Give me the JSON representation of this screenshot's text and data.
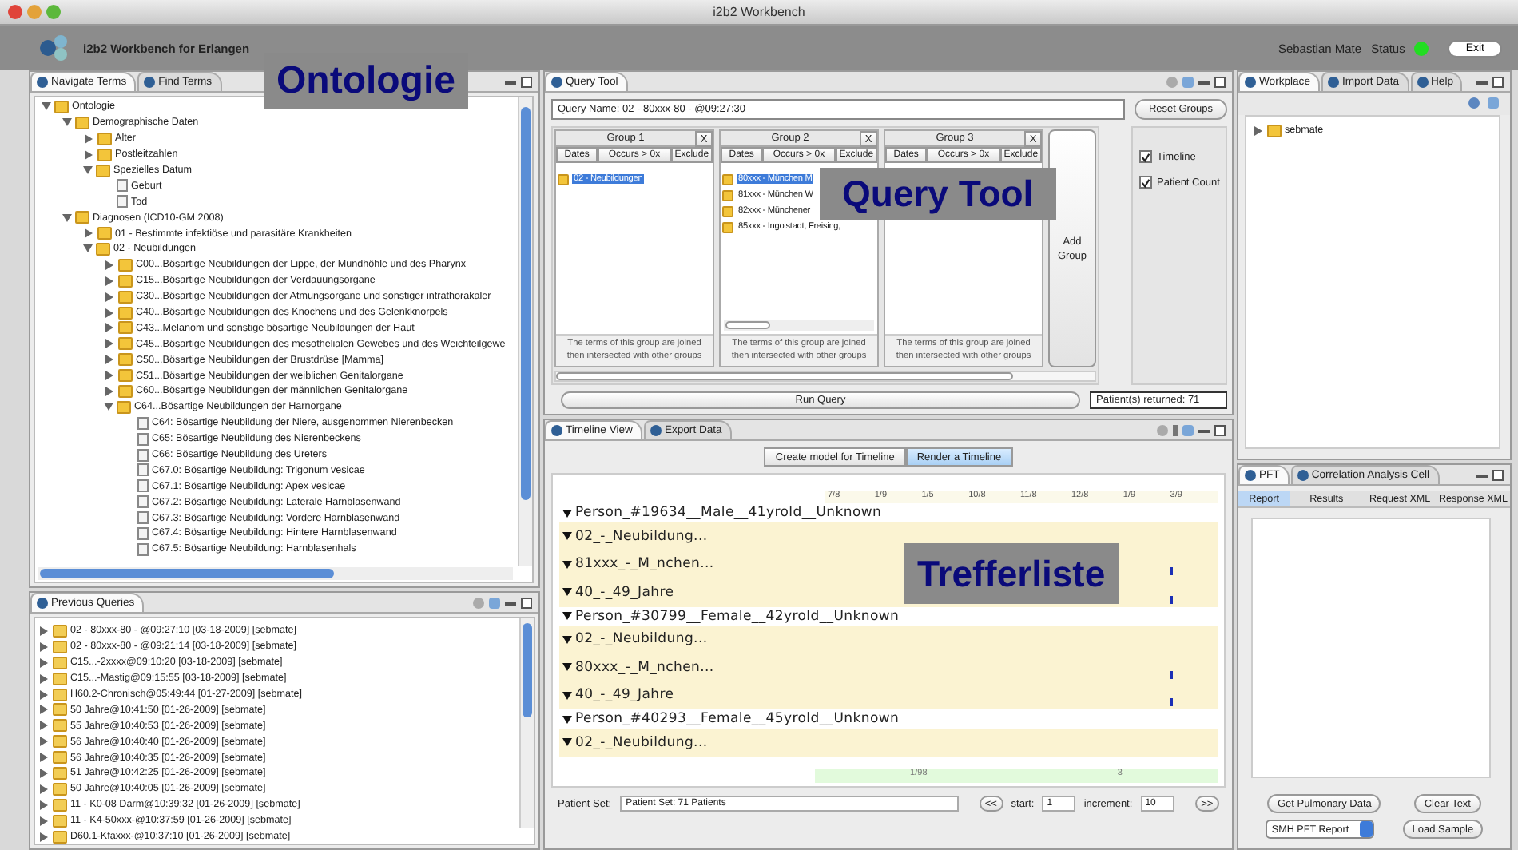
{
  "window": {
    "title": "i2b2 Workbench"
  },
  "header": {
    "app_title": "i2b2 Workbench for Erlangen",
    "user": "Sebastian Mate",
    "status_label": "Status",
    "connected": true,
    "exit_button": "Exit"
  },
  "navigate": {
    "tabs": [
      {
        "label": "Navigate Terms",
        "selected": true
      },
      {
        "label": "Find Terms",
        "selected": false
      }
    ],
    "callout": "Ontologie",
    "tree": [
      {
        "label": "Ontologie",
        "kind": "folder",
        "expanded": true,
        "children": [
          {
            "label": "Demographische Daten",
            "kind": "folder",
            "expanded": true,
            "children": [
              {
                "label": "Alter",
                "kind": "folder",
                "expanded": false
              },
              {
                "label": "Postleitzahlen",
                "kind": "folder",
                "expanded": false
              },
              {
                "label": "Spezielles Datum",
                "kind": "folder",
                "expanded": true,
                "children": [
                  {
                    "label": "Geburt",
                    "kind": "leaf"
                  },
                  {
                    "label": "Tod",
                    "kind": "leaf"
                  }
                ]
              }
            ]
          },
          {
            "label": "Diagnosen (ICD10-GM 2008)",
            "kind": "folder",
            "expanded": true,
            "children": [
              {
                "label": "01 - Bestimmte infektiöse und parasitäre Krankheiten",
                "kind": "folder",
                "expanded": false
              },
              {
                "label": "02 - Neubildungen",
                "kind": "folder",
                "expanded": true,
                "children": [
                  {
                    "label": "C00...Bösartige Neubildungen der Lippe, der Mundhöhle und des Pharynx",
                    "kind": "folder",
                    "expanded": false
                  },
                  {
                    "label": "C15...Bösartige Neubildungen der Verdauungsorgane",
                    "kind": "folder",
                    "expanded": false
                  },
                  {
                    "label": "C30...Bösartige Neubildungen der Atmungsorgane und sonstiger intrathorakaler",
                    "kind": "folder",
                    "expanded": false
                  },
                  {
                    "label": "C40...Bösartige Neubildungen des Knochens und des Gelenkknorpels",
                    "kind": "folder",
                    "expanded": false
                  },
                  {
                    "label": "C43...Melanom und sonstige bösartige Neubildungen der Haut",
                    "kind": "folder",
                    "expanded": false
                  },
                  {
                    "label": "C45...Bösartige Neubildungen des mesothelialen Gewebes und des Weichteilgewe",
                    "kind": "folder",
                    "expanded": false
                  },
                  {
                    "label": "C50...Bösartige Neubildungen der Brustdrüse [Mamma]",
                    "kind": "folder",
                    "expanded": false
                  },
                  {
                    "label": "C51...Bösartige Neubildungen der weiblichen Genitalorgane",
                    "kind": "folder",
                    "expanded": false
                  },
                  {
                    "label": "C60...Bösartige Neubildungen der männlichen Genitalorgane",
                    "kind": "folder",
                    "expanded": false
                  },
                  {
                    "label": "C64...Bösartige Neubildungen der Harnorgane",
                    "kind": "folder",
                    "expanded": true,
                    "children": [
                      {
                        "label": "C64: Bösartige Neubildung der Niere, ausgenommen Nierenbecken",
                        "kind": "leaf"
                      },
                      {
                        "label": "C65: Bösartige Neubildung des Nierenbeckens",
                        "kind": "leaf"
                      },
                      {
                        "label": "C66: Bösartige Neubildung des Ureters",
                        "kind": "leaf"
                      },
                      {
                        "label": "C67.0: Bösartige Neubildung: Trigonum vesicae",
                        "kind": "leaf"
                      },
                      {
                        "label": "C67.1: Bösartige Neubildung: Apex vesicae",
                        "kind": "leaf"
                      },
                      {
                        "label": "C67.2: Bösartige Neubildung: Laterale Harnblasenwand",
                        "kind": "leaf"
                      },
                      {
                        "label": "C67.3: Bösartige Neubildung: Vordere Harnblasenwand",
                        "kind": "leaf"
                      },
                      {
                        "label": "C67.4: Bösartige Neubildung: Hintere Harnblasenwand",
                        "kind": "leaf"
                      },
                      {
                        "label": "C67.5: Bösartige Neubildung: Harnblasenhals",
                        "kind": "leaf"
                      }
                    ]
                  }
                ]
              }
            ]
          }
        ]
      }
    ]
  },
  "previous_queries": {
    "tabs": [
      {
        "label": "Previous Queries",
        "selected": true
      }
    ],
    "items": [
      "02 - 80xxx-80 - @09:27:10 [03-18-2009] [sebmate]",
      "02 - 80xxx-80 - @09:21:14 [03-18-2009] [sebmate]",
      "C15...-2xxxx@09:10:20 [03-18-2009] [sebmate]",
      "C15...-Mastig@09:15:55 [03-18-2009] [sebmate]",
      "H60.2-Chronisch@05:49:44 [01-27-2009] [sebmate]",
      "50 Jahre@10:41:50 [01-26-2009] [sebmate]",
      "55 Jahre@10:40:53 [01-26-2009] [sebmate]",
      "56 Jahre@10:40:40 [01-26-2009] [sebmate]",
      "56 Jahre@10:40:35 [01-26-2009] [sebmate]",
      "51 Jahre@10:42:25 [01-26-2009] [sebmate]",
      "50 Jahre@10:40:05 [01-26-2009] [sebmate]",
      "11 - K0-08 Darm@10:39:32 [01-26-2009] [sebmate]",
      "11 - K4-50xxx-@10:37:59 [01-26-2009] [sebmate]",
      "D60.1-Kfaxxx-@10:37:10 [01-26-2009] [sebmate]"
    ]
  },
  "query_tool": {
    "tabs": [
      {
        "label": "Query Tool",
        "selected": true
      }
    ],
    "callout": "Query Tool",
    "query_name": "Query Name: 02 - 80xxx-80 - @09:27:30",
    "reset_button": "Reset Groups",
    "groups": [
      {
        "title": "Group 1",
        "remove": "X",
        "columns": [
          "Dates",
          "Occurs > 0x",
          "Exclude"
        ],
        "items": [
          {
            "label": "02 - Neubildungen",
            "selected": true
          }
        ],
        "footer": "The terms of this group are joined then intersected with other groups",
        "scrollbar": false
      },
      {
        "title": "Group 2",
        "remove": "X",
        "columns": [
          "Dates",
          "Occurs > 0x",
          "Exclude"
        ],
        "items": [
          {
            "label": "80xxx - München M",
            "selected": true
          },
          {
            "label": "81xxx - München W",
            "selected": false
          },
          {
            "label": "82xxx - Münchener",
            "selected": false
          },
          {
            "label": "85xxx - Ingolstadt, Freising,",
            "selected": false
          }
        ],
        "footer": "The terms of this group are joined then intersected with other groups",
        "scrollbar": true
      },
      {
        "title": "Group 3",
        "remove": "X",
        "columns": [
          "Dates",
          "Occurs > 0x",
          "Exclude"
        ],
        "footer": "The terms of this group are joined then intersected with other groups",
        "scrollbar": false
      }
    ],
    "add_group": "Add Group",
    "options": [
      {
        "label": "Timeline",
        "checked": true
      },
      {
        "label": "Patient Count",
        "checked": true
      }
    ],
    "run_button": "Run Query",
    "result": "Patient(s) returned: 71"
  },
  "timeline": {
    "tabs": [
      {
        "label": "Timeline View",
        "selected": true
      },
      {
        "label": "Export Data",
        "selected": false
      }
    ],
    "callout": "Trefferliste",
    "modes": [
      {
        "label": "Create model for Timeline",
        "selected": false
      },
      {
        "label": "Render a Timeline",
        "selected": true
      }
    ],
    "axis": [
      "7/8",
      "1/9",
      "1/5",
      "10/8",
      "11/8",
      "12/8",
      "1/9",
      "3/9"
    ],
    "rows": [
      {
        "label": "Person_#19634__Male__41yrold__Unknown",
        "kind": "person",
        "event": false
      },
      {
        "label": "02_-_Neubildung...",
        "kind": "concept",
        "event": false
      },
      {
        "label": "81xxx_-_M_nchen...",
        "kind": "concept",
        "event": true
      },
      {
        "label": "40_-_49_Jahre",
        "kind": "concept",
        "event": true
      },
      {
        "label": "Person_#30799__Female__42yrold__Unknown",
        "kind": "person",
        "event": false
      },
      {
        "label": "02_-_Neubildung...",
        "kind": "concept",
        "event": false
      },
      {
        "label": "80xxx_-_M_nchen...",
        "kind": "concept",
        "event": true
      },
      {
        "label": "40_-_49_Jahre",
        "kind": "concept",
        "event": true
      },
      {
        "label": "Person_#40293__Female__45yrold__Unknown",
        "kind": "person",
        "event": false
      },
      {
        "label": "02_-_Neubildung...",
        "kind": "concept",
        "event": false
      }
    ],
    "range_start": "1/98",
    "range_end": "3",
    "patient_set_label": "Patient Set:",
    "patient_set": "Patient Set: 71 Patients",
    "prev_button": "<<",
    "start_label": "start:",
    "start": "1",
    "increment_label": "increment:",
    "increment": "10",
    "next_button": ">>"
  },
  "workplace": {
    "tabs": [
      {
        "label": "Workplace",
        "selected": true
      },
      {
        "label": "Import Data",
        "selected": false
      },
      {
        "label": "Help",
        "selected": false
      }
    ],
    "tree": [
      {
        "label": "sebmate",
        "expanded": false
      }
    ]
  },
  "pft": {
    "tabs": [
      {
        "label": "PFT",
        "selected": true
      },
      {
        "label": "Correlation Analysis Cell",
        "selected": false
      }
    ],
    "subtabs": [
      {
        "label": "Report",
        "selected": true
      },
      {
        "label": "Results",
        "selected": false
      },
      {
        "label": "Request XML",
        "selected": false
      },
      {
        "label": "Response XML",
        "selected": false
      }
    ],
    "buttons": [
      "Get Pulmonary Data",
      "Clear Text"
    ],
    "select": "SMH PFT Report",
    "load_button": "Load Sample"
  }
}
